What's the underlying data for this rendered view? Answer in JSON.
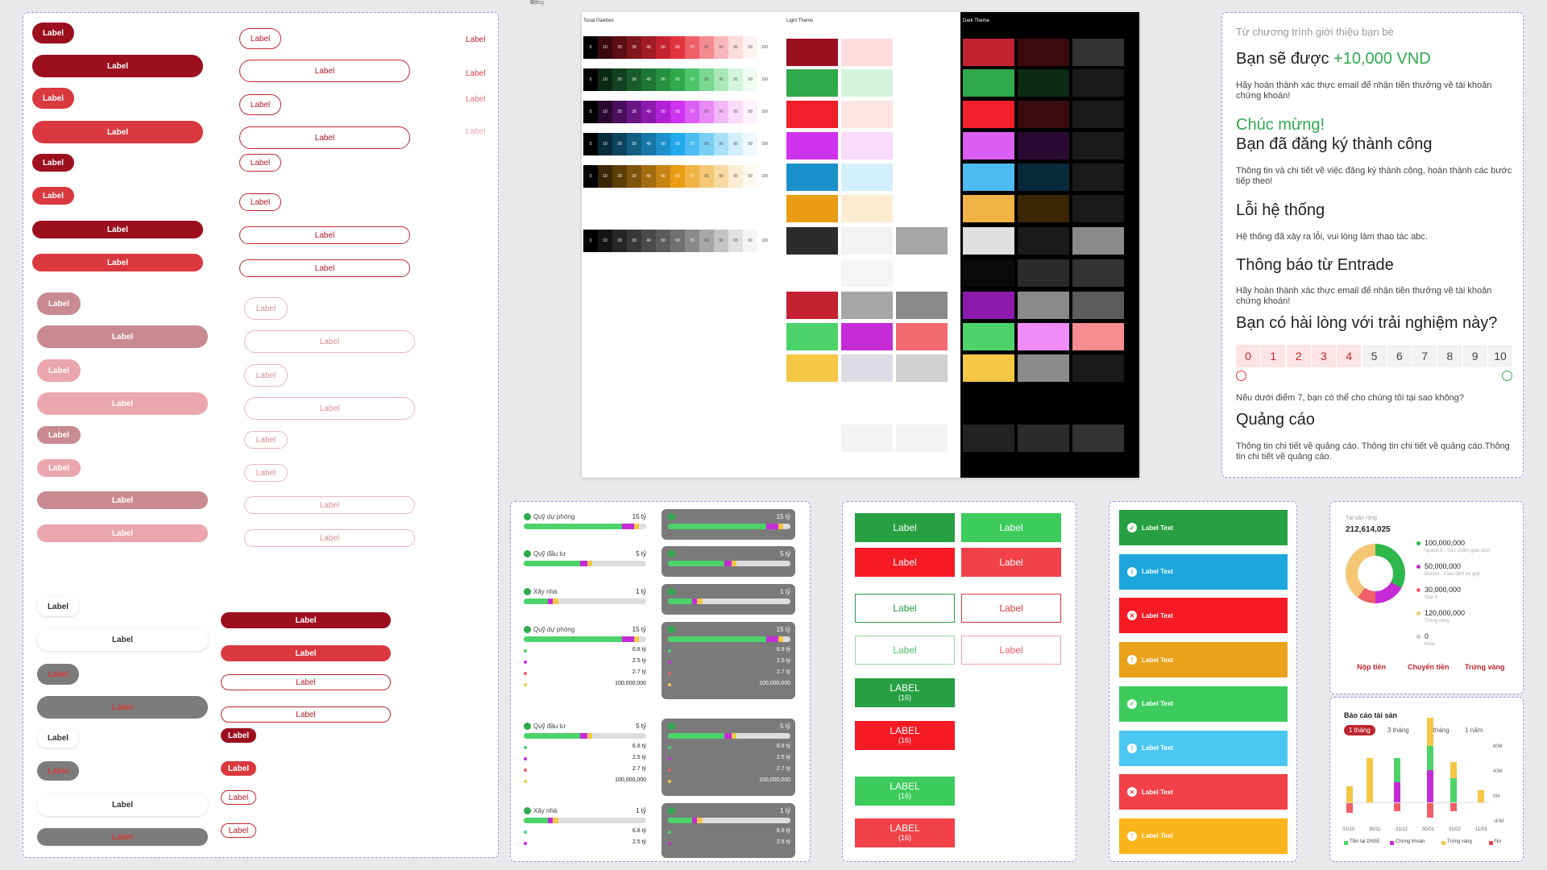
{
  "buttons": {
    "label": "Label"
  },
  "palette": {
    "title": "Tonal Palettes",
    "light": "Light Theme",
    "dark": "Dark Theme",
    "steps": [
      "0",
      "10",
      "20",
      "30",
      "40",
      "50",
      "60",
      "70",
      "80",
      "90",
      "95",
      "99",
      "100"
    ],
    "rows": [
      [
        "#000",
        "#3b0a0e",
        "#5c0f15",
        "#7f151d",
        "#a01c26",
        "#c42230",
        "#e2343f",
        "#ef5f67",
        "#f68b91",
        "#fbb8bc",
        "#fddcde",
        "#fff3f4",
        "#fff"
      ],
      [
        "#000",
        "#0b2a14",
        "#124220",
        "#195b2b",
        "#1f7535",
        "#268f40",
        "#2eaa4c",
        "#4cc46a",
        "#7ad891",
        "#a9e8b8",
        "#d3f4db",
        "#f0fbf3",
        "#fff"
      ],
      [
        "#000",
        "#2a0a33",
        "#4a0f5c",
        "#6b1585",
        "#8c1aad",
        "#b020d6",
        "#ce33f0",
        "#dc5ff4",
        "#e88bf7",
        "#f2b8fa",
        "#f9dcfc",
        "#fdf3fe",
        "#fff"
      ],
      [
        "#000",
        "#082a3b",
        "#0d435e",
        "#125d82",
        "#1776a6",
        "#1c90ca",
        "#22a9ed",
        "#4dbcf1",
        "#7acff5",
        "#a8e0f9",
        "#d3effc",
        "#f0f9fe",
        "#fff"
      ],
      [
        "#000",
        "#3a2605",
        "#5c3d08",
        "#7f540b",
        "#a36c0e",
        "#c78412",
        "#ea9c15",
        "#f0b345",
        "#f5c775",
        "#f9dba5",
        "#fcedd2",
        "#fef9f0",
        "#fff"
      ],
      [
        "#000",
        "#141414",
        "#262626",
        "#383838",
        "#4a4a4a",
        "#5c5c5c",
        "#707070",
        "#8a8a8a",
        "#a6a6a6",
        "#c4c4c4",
        "#e0e0e0",
        "#f5f5f5",
        "#fff"
      ]
    ]
  },
  "survey": {
    "intro": "Từ chương trình giới thiệu bạn bè",
    "h1a": "Bạn sẽ được ",
    "h1b": "+10,000 VND",
    "p1": "Hãy hoàn thành xác thực email để nhận tiền thưởng về tài khoản chứng khoán!",
    "congrats": "Chúc mừng!",
    "h2": "Bạn đã đăng ký thành công",
    "p2": "Thông tin và chi tiết về việc đăng ký thành công, hoàn thành các bước tiếp theo!",
    "h3": "Lỗi hệ thống",
    "p3": "Hệ thống đã xảy ra lỗi, vui lòng làm thao tác abc.",
    "h4": "Thông báo từ Entrade",
    "p4": "Hãy hoàn thành xác thực email để nhận tiền thưởng về tài khoản chứng khoán!",
    "h5": "Bạn có hài lòng với trải nghiệm này?",
    "nps": [
      "0",
      "1",
      "2",
      "3",
      "4",
      "5",
      "6",
      "7",
      "8",
      "9",
      "10"
    ],
    "p5": "Nếu dưới điểm 7, bạn có thể cho chúng tôi tại sao không?",
    "h6": "Quảng cáo",
    "p6": "Thông tin chi tiết về quảng cáo. Thông tin chi tiết về quảng cáo.Thông tin chi tiết về quảng cáo."
  },
  "funds": {
    "f1": "Quỹ dự phòng",
    "f2": "Quỹ đầu tư",
    "f3": "Xây nhà",
    "v15": "15 tỷ",
    "v5": "5 tỷ",
    "v1": "1 tỷ",
    "items": [
      "Vợi",
      "Công",
      "Vợt",
      "Ăn"
    ],
    "vals": [
      "6.8 tỷ",
      "2.5 tỷ",
      "2.7 tỷ",
      "100,000,000"
    ],
    "items2": [
      "Hai",
      "Công"
    ]
  },
  "big": {
    "label": "Label",
    "upper": "LABEL",
    "count": "(16)"
  },
  "toasts": {
    "text": "Label Text"
  },
  "asset": {
    "title": "Tài sản ròng",
    "total": "212,614,025",
    "legend": [
      {
        "v": "100,000,000",
        "s": "Space X - Sản phẩm giao dịch",
        "c": "#2eb84c"
      },
      {
        "v": "50,000,000",
        "s": "Rocket - Giao dịch ký quỹ",
        "c": "#c52bd6"
      },
      {
        "v": "30,000,000",
        "s": "Star X",
        "c": "#ef5f67"
      },
      {
        "v": "120,000,000",
        "s": "Trứng vàng",
        "c": "#f5c775"
      },
      {
        "v": "0",
        "s": "Khác",
        "c": "#ccc"
      }
    ],
    "actions": [
      "Nộp tiền",
      "Chuyển tiền",
      "Trứng vàng"
    ]
  },
  "report": {
    "title": "Báo cáo tài sản",
    "tabs": [
      "1 tháng",
      "3 tháng",
      "6 tháng",
      "1 năm"
    ],
    "x": [
      "31/10",
      "30/11",
      "31/12",
      "30/01",
      "31/02",
      "11/03"
    ],
    "y": [
      "80M",
      "40M",
      "0M",
      "-40M"
    ],
    "legend": [
      "Tiền tại DNSE",
      "Chứng khoán",
      "Trứng vàng",
      "Nợ"
    ]
  }
}
